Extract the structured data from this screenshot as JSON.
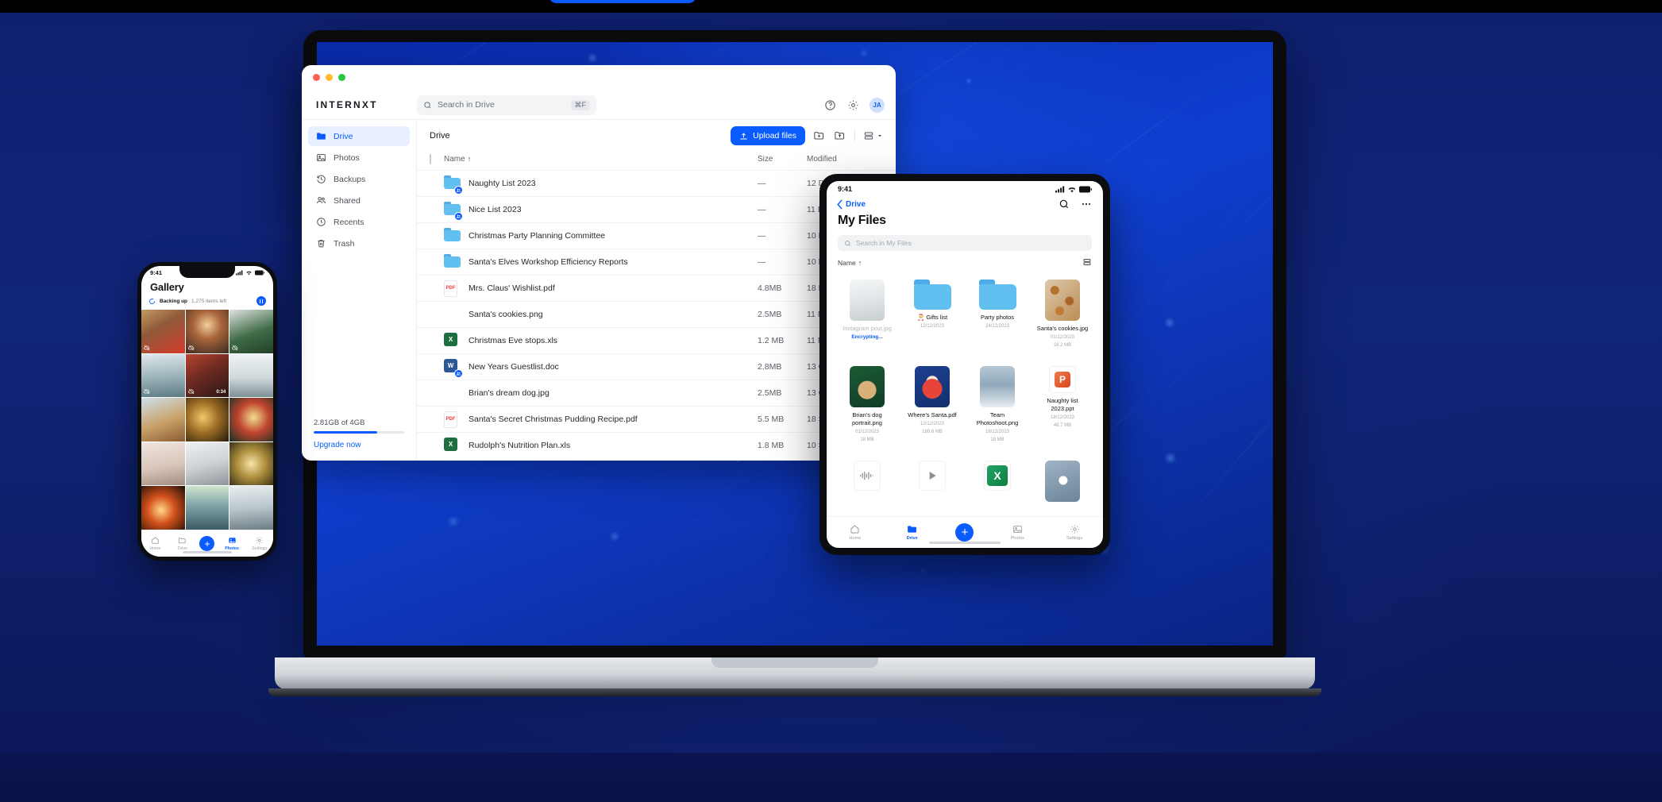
{
  "background": {
    "accent": "#0b5cff",
    "deep_blue": "#0c1f6b"
  },
  "desktop": {
    "brand": "INTERNXT",
    "search": {
      "placeholder": "Search in Drive",
      "shortcut": "⌘F",
      "icon": "search-icon"
    },
    "topbar_icons": [
      {
        "name": "help-icon",
        "glyph": "?"
      },
      {
        "name": "settings-gear-icon",
        "glyph": "gear"
      }
    ],
    "avatar_initials": "JA",
    "sidebar": {
      "items": [
        {
          "label": "Drive",
          "icon": "folder-icon",
          "active": true
        },
        {
          "label": "Photos",
          "icon": "image-icon",
          "active": false
        },
        {
          "label": "Backups",
          "icon": "history-icon",
          "active": false
        },
        {
          "label": "Shared",
          "icon": "people-icon",
          "active": false
        },
        {
          "label": "Recents",
          "icon": "clock-icon",
          "active": false
        },
        {
          "label": "Trash",
          "icon": "trash-icon",
          "active": false
        }
      ],
      "storage_text": "2.81GB of 4GB",
      "storage_percent": 70,
      "upgrade_label": "Upgrade now"
    },
    "breadcrumb": "Drive",
    "toolbar": {
      "upload_label": "Upload files",
      "upload_icon": "upload-icon",
      "new_folder_icon": "folder-plus-icon",
      "upload_folder_icon": "folder-upload-icon",
      "view_toggle_icon": "list-view-icon"
    },
    "table": {
      "headers": {
        "name": "Name",
        "size": "Size",
        "modified": "Modified"
      },
      "sort_indicator": "↑",
      "rows": [
        {
          "name": "Naughty List 2023",
          "size": "—",
          "modified": "12 December 2023",
          "icon": "folder-shared-icon"
        },
        {
          "name": "Nice List 2023",
          "size": "—",
          "modified": "11 December 2023",
          "icon": "folder-shared-icon"
        },
        {
          "name": "Christmas Party Planning Committee",
          "size": "—",
          "modified": "10 December 2023",
          "icon": "folder-icon"
        },
        {
          "name": "Santa's Elves Workshop Efficiency Reports",
          "size": "—",
          "modified": "10 December 2023",
          "icon": "folder-icon"
        },
        {
          "name": "Mrs. Claus' Wishlist.pdf",
          "size": "4.8MB",
          "modified": "18 December 2023",
          "icon": "pdf-icon"
        },
        {
          "name": "Santa's cookies.png",
          "size": "2.5MB",
          "modified": "11 November 2023",
          "icon": "image-thumb-cookies"
        },
        {
          "name": "Christmas Eve stops.xls",
          "size": "1.2 MB",
          "modified": "11 November 2023",
          "icon": "excel-icon"
        },
        {
          "name": "New Years Guestlist.doc",
          "size": "2.8MB",
          "modified": "13 October 2023",
          "icon": "word-shared-icon"
        },
        {
          "name": "Brian's dream dog.jpg",
          "size": "2.5MB",
          "modified": "13 October 2023",
          "icon": "image-thumb-dog"
        },
        {
          "name": "Santa's Secret Christmas Pudding Recipe.pdf",
          "size": "5.5 MB",
          "modified": "18 September 2023",
          "icon": "pdf-icon"
        },
        {
          "name": "Rudolph's Nutrition Plan.xls",
          "size": "1.8 MB",
          "modified": "10 September 2023",
          "icon": "excel-icon"
        }
      ]
    }
  },
  "phone": {
    "status": {
      "time": "9:41",
      "signal_icon": "cellular-icon",
      "wifi_icon": "wifi-icon",
      "battery_icon": "battery-icon"
    },
    "title": "Gallery",
    "backup": {
      "label": "Backing up",
      "count": "1,275 items left",
      "spinner_icon": "spinner-icon",
      "pause_icon": "pause-icon"
    },
    "tabs": [
      {
        "label": "Home",
        "icon": "home-icon",
        "active": false
      },
      {
        "label": "Drive",
        "icon": "folder-outline-icon",
        "active": false
      },
      {
        "label": "",
        "icon": "plus-fab-icon",
        "active": false
      },
      {
        "label": "Photos",
        "icon": "photos-icon",
        "active": true
      },
      {
        "label": "Settings",
        "icon": "gear-icon",
        "active": false
      }
    ],
    "photos": [
      {
        "alt": "gift-wreath-bookshelf",
        "offline": true
      },
      {
        "alt": "carousel-market",
        "offline": true
      },
      {
        "alt": "christmas-tree-room",
        "offline": true
      },
      {
        "alt": "woman-boat-lake",
        "offline": true
      },
      {
        "alt": "couple-kissing",
        "offline": true,
        "duration": "0:34"
      },
      {
        "alt": "family-choosing-tree",
        "offline": false
      },
      {
        "alt": "dog-santa-hat",
        "offline": false
      },
      {
        "alt": "cookies-bowl-lights",
        "offline": false
      },
      {
        "alt": "bokeh-lights",
        "offline": false
      },
      {
        "alt": "family-fireplace-stockings",
        "offline": false
      },
      {
        "alt": "cat-with-bells",
        "offline": false
      },
      {
        "alt": "hanging-cards-lights",
        "offline": false
      },
      {
        "alt": "bonfire",
        "offline": false
      },
      {
        "alt": "mountain-sunrise",
        "offline": false
      },
      {
        "alt": "snowy-forest",
        "offline": false
      }
    ]
  },
  "tablet": {
    "status": {
      "time": "9:41",
      "signal_icon": "cellular-icon",
      "wifi_icon": "wifi-icon",
      "battery_icon": "battery-icon"
    },
    "back_label": "Drive",
    "back_icon": "chevron-left-icon",
    "search_icon": "search-icon",
    "more_icon": "more-horizontal-icon",
    "title": "My Files",
    "search_placeholder": "Search in My Files",
    "sort_label": "Name",
    "sort_indicator": "↑",
    "view_toggle_icon": "list-view-icon",
    "items": [
      {
        "name": "Instagram post.jpg",
        "date": "",
        "size": "",
        "status": "Encrypting...",
        "icon": "image-thumb-instagram",
        "muted": true
      },
      {
        "name": "🎅 Gifts list",
        "date": "12/12/2023",
        "size": "",
        "status": "",
        "icon": "folder-icon",
        "muted": false
      },
      {
        "name": "Party photos",
        "date": "24/12/2023",
        "size": "",
        "status": "",
        "icon": "folder-icon",
        "muted": false
      },
      {
        "name": "Santa's cookies.jpg",
        "date": "01/12/2023",
        "size": "16.2 MB",
        "status": "",
        "icon": "image-thumb-cookies",
        "muted": false
      },
      {
        "name": "Brian's dog portrait.png",
        "date": "01/12/2023",
        "size": "18 MB",
        "status": "",
        "icon": "image-thumb-dog",
        "muted": false
      },
      {
        "name": "Where's Santa.pdf",
        "date": "12/12/2023",
        "size": "180.6 MB",
        "status": "",
        "icon": "image-thumb-santa-book",
        "muted": false
      },
      {
        "name": "Team Photoshoot.png",
        "date": "18/12/2023",
        "size": "18 MB",
        "status": "",
        "icon": "image-thumb-snow-team",
        "muted": false
      },
      {
        "name": "Naughty list 2023.ppt",
        "date": "18/12/2023",
        "size": "48.7 MB",
        "status": "",
        "icon": "powerpoint-icon",
        "muted": false
      },
      {
        "name": "",
        "date": "",
        "size": "",
        "status": "",
        "icon": "audio-waveform-icon",
        "muted": false
      },
      {
        "name": "",
        "date": "",
        "size": "",
        "status": "",
        "icon": "video-play-icon",
        "muted": false
      },
      {
        "name": "",
        "date": "",
        "size": "",
        "status": "",
        "icon": "excel-icon",
        "muted": false
      },
      {
        "name": "",
        "date": "",
        "size": "",
        "status": "",
        "icon": "image-thumb-snowflake",
        "muted": false
      }
    ],
    "tabs": [
      {
        "label": "Home",
        "icon": "home-icon",
        "active": false
      },
      {
        "label": "Drive",
        "icon": "folder-icon",
        "active": true
      },
      {
        "label": "",
        "icon": "plus-fab-icon",
        "active": false
      },
      {
        "label": "Photos",
        "icon": "photos-icon",
        "active": false
      },
      {
        "label": "Settings",
        "icon": "gear-icon",
        "active": false
      }
    ]
  }
}
